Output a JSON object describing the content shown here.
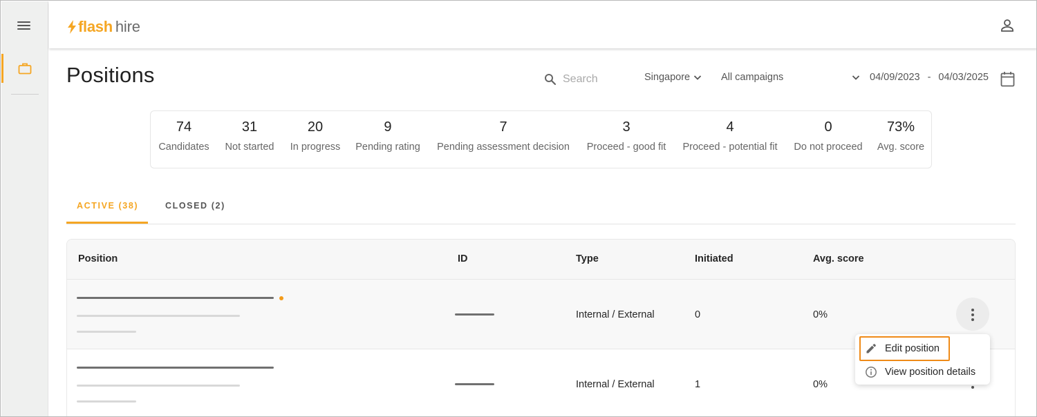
{
  "app": {
    "logo_flash": "flash",
    "logo_hire": "hire",
    "brand_color": "#f5a623"
  },
  "header": {
    "title": "Positions",
    "search_placeholder": "Search",
    "country": "Singapore",
    "campaigns": "All campaigns",
    "date_from": "04/09/2023",
    "date_separator": "-",
    "date_to": "04/03/2025"
  },
  "stats": [
    {
      "value": "74",
      "label": "Candidates"
    },
    {
      "value": "31",
      "label": "Not started"
    },
    {
      "value": "20",
      "label": "In progress"
    },
    {
      "value": "9",
      "label": "Pending rating"
    },
    {
      "value": "7",
      "label": "Pending assessment decision"
    },
    {
      "value": "3",
      "label": "Proceed - good fit"
    },
    {
      "value": "4",
      "label": "Proceed - potential fit"
    },
    {
      "value": "0",
      "label": "Do not proceed"
    },
    {
      "value": "73%",
      "label": "Avg. score"
    }
  ],
  "tabs": {
    "active": "ACTIVE (38)",
    "closed": "CLOSED (2)"
  },
  "table": {
    "columns": [
      "Position",
      "ID",
      "Type",
      "Initiated",
      "Avg. score"
    ],
    "rows": [
      {
        "type": "Internal / External",
        "initiated": "0",
        "avg_score": "0%"
      },
      {
        "type": "Internal / External",
        "initiated": "1",
        "avg_score": "0%"
      }
    ]
  },
  "row_menu": {
    "edit": "Edit position",
    "view": "View position details"
  },
  "icons": {
    "menu": "hamburger-menu-icon",
    "nav": "briefcase-icon",
    "user": "user-icon",
    "search": "search-icon",
    "calendar": "calendar-icon",
    "edit": "pencil-icon",
    "info": "info-icon"
  }
}
